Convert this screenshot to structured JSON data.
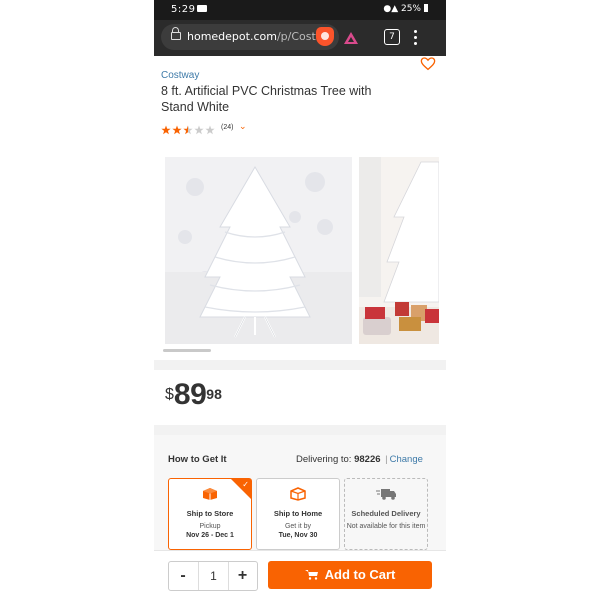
{
  "status_bar": {
    "time": "5:29",
    "right": "25%"
  },
  "browser": {
    "url_host": "homedepot.com",
    "url_path": "/p/Cost",
    "tab_count": "7"
  },
  "product": {
    "brand": "Costway",
    "title": "8 ft. Artificial PVC Christmas Tree with Stand White",
    "rating": 2.5,
    "rating_max": 5,
    "review_count": "(24)"
  },
  "price": {
    "currency": "$",
    "dollars": "89",
    "cents": "98"
  },
  "fulfillment": {
    "heading": "How to Get It",
    "delivering_label": "Delivering to:",
    "zip": "98226",
    "separator": "|",
    "change_label": "Change",
    "options": [
      {
        "label": "Ship to Store",
        "sub": "Pickup",
        "sub2": "Nov 26 - Dec 1",
        "selected": true
      },
      {
        "label": "Ship to Home",
        "sub": "Get it by",
        "sub2": "Tue, Nov 30",
        "selected": false
      },
      {
        "label": "Scheduled Delivery",
        "sub": "Not available for this item",
        "sub2": "",
        "selected": false
      }
    ]
  },
  "cart": {
    "minus": "-",
    "quantity": "1",
    "plus": "+",
    "add_to_cart_label": "Add to Cart"
  },
  "colors": {
    "accent": "#f96302",
    "link": "#3e7aa8",
    "star": "#f96302"
  }
}
